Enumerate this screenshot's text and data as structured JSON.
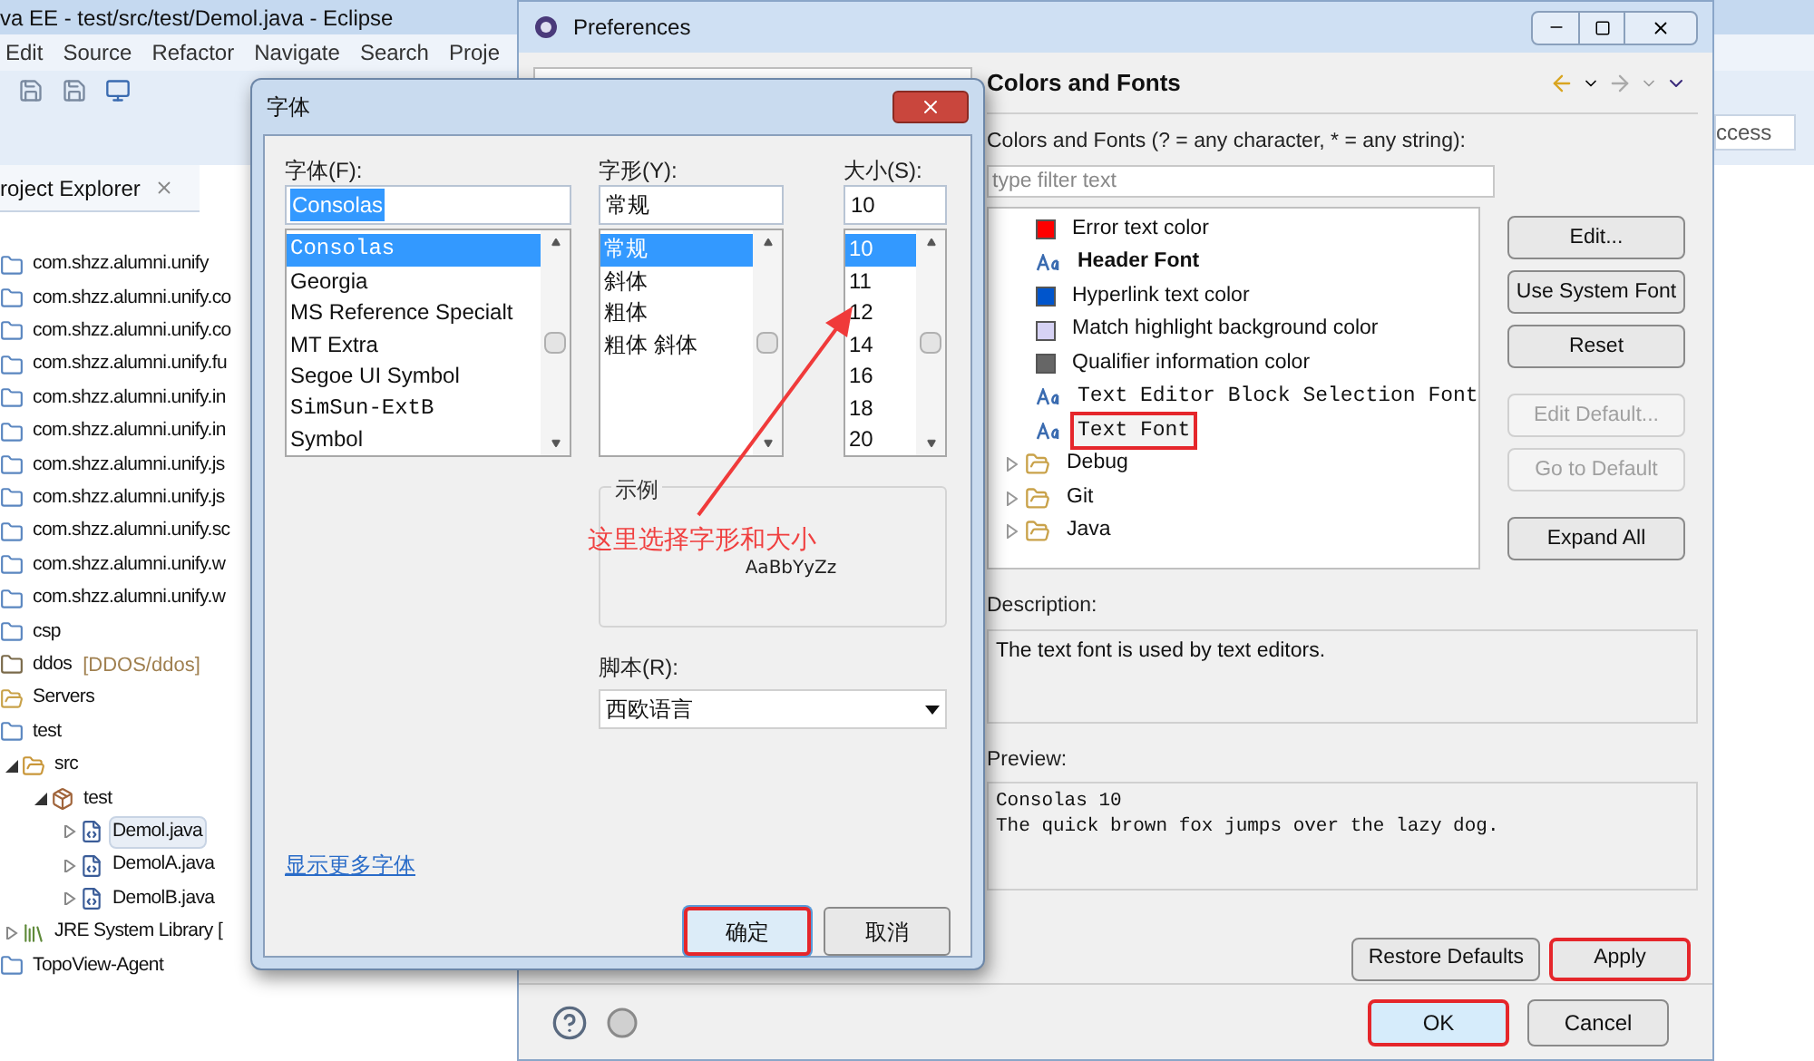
{
  "eclipse": {
    "title": "va EE - test/src/test/Demol.java - Eclipse",
    "menu": [
      "Edit",
      "Source",
      "Refactor",
      "Navigate",
      "Search",
      "Proje"
    ],
    "quick_access": "ccess"
  },
  "project_explorer": {
    "title": "roject Explorer",
    "items": [
      {
        "label": "com.shzz.alumni.unify",
        "kind": "project"
      },
      {
        "label": "com.shzz.alumni.unify.co",
        "kind": "project"
      },
      {
        "label": "com.shzz.alumni.unify.co",
        "kind": "project"
      },
      {
        "label": "com.shzz.alumni.unify.fu",
        "kind": "project"
      },
      {
        "label": "com.shzz.alumni.unify.in",
        "kind": "project"
      },
      {
        "label": "com.shzz.alumni.unify.in",
        "kind": "project"
      },
      {
        "label": "com.shzz.alumni.unify.js",
        "kind": "project"
      },
      {
        "label": "com.shzz.alumni.unify.js",
        "kind": "project"
      },
      {
        "label": "com.shzz.alumni.unify.sc",
        "kind": "project"
      },
      {
        "label": "com.shzz.alumni.unify.w",
        "kind": "project"
      },
      {
        "label": "com.shzz.alumni.unify.w",
        "kind": "project"
      },
      {
        "label": "csp",
        "kind": "project"
      },
      {
        "label": "ddos",
        "suffix": "[DDOS/ddos]",
        "kind": "repo"
      },
      {
        "label": "Servers",
        "kind": "folder"
      },
      {
        "label": "test",
        "kind": "project",
        "children": [
          {
            "label": "src",
            "kind": "source",
            "expanded": true,
            "children": [
              {
                "label": "test",
                "kind": "package",
                "expanded": true,
                "children": [
                  {
                    "label": "Demol.java",
                    "kind": "java",
                    "expanded": false,
                    "selected": true
                  },
                  {
                    "label": "DemolA.java",
                    "kind": "java",
                    "expanded": false,
                    "selected": false
                  },
                  {
                    "label": "DemolB.java",
                    "kind": "java",
                    "expanded": false,
                    "selected": false
                  }
                ]
              }
            ]
          },
          {
            "label": "JRE System Library [",
            "kind": "library",
            "expanded": false
          }
        ]
      },
      {
        "label": "TopoView-Agent",
        "kind": "project"
      }
    ]
  },
  "preferences": {
    "title": "Preferences",
    "page_title": "Colors and Fonts",
    "filter_label": "Colors and Fonts (? = any character, * = any string):",
    "filter_placeholder": "type filter text",
    "tree": [
      {
        "label": "Error text color",
        "kind": "color",
        "color": "#ff0000",
        "selected": false,
        "annotated": false
      },
      {
        "label": "Header Font",
        "kind": "font",
        "selected": false,
        "annotated": false
      },
      {
        "label": "Hyperlink text color",
        "kind": "color",
        "color": "#0055cc",
        "selected": false,
        "annotated": false
      },
      {
        "label": "Match highlight background color",
        "kind": "color",
        "color": "#d6d2f4",
        "selected": false,
        "annotated": false
      },
      {
        "label": "Qualifier information color",
        "kind": "color",
        "color": "#666666",
        "selected": false,
        "annotated": false
      },
      {
        "label": "Text Editor Block Selection Font",
        "kind": "font",
        "selected": false,
        "annotated": false
      },
      {
        "label": "Text Font",
        "kind": "font",
        "selected": true,
        "annotated": true
      },
      {
        "label": "Debug",
        "kind": "category",
        "expanded": false
      },
      {
        "label": "Git",
        "kind": "category",
        "expanded": false
      },
      {
        "label": "Java",
        "kind": "category",
        "expanded": false
      }
    ],
    "side_buttons": [
      {
        "label": "Edit...",
        "disabled": false
      },
      {
        "label": "Use System Font",
        "disabled": false
      },
      {
        "label": "Reset",
        "disabled": false
      },
      {
        "label": "Edit Default...",
        "disabled": true
      },
      {
        "label": "Go to Default",
        "disabled": true
      },
      {
        "label": "Expand All",
        "disabled": false
      }
    ],
    "description_label": "Description:",
    "description": "The text font is used by text editors.",
    "preview_label": "Preview:",
    "preview": [
      "Consolas 10",
      "The quick brown fox jumps over the lazy dog."
    ],
    "page_buttons": [
      {
        "label": "Restore Defaults",
        "annotated": false
      },
      {
        "label": "Apply",
        "annotated": true
      }
    ],
    "dialog_buttons": [
      {
        "label": "OK",
        "annotated": true,
        "default": true
      },
      {
        "label": "Cancel",
        "annotated": false,
        "default": false
      }
    ]
  },
  "font_dialog": {
    "title": "字体",
    "font": {
      "label": "字体(F):",
      "value": "Consolas",
      "options": [
        {
          "label": "Consolas",
          "selected": true
        },
        {
          "label": "Georgia",
          "selected": false
        },
        {
          "label": "MS Reference Specialt",
          "selected": false
        },
        {
          "label": "MT Extra",
          "selected": false
        },
        {
          "label": "Segoe UI Symbol",
          "selected": false
        },
        {
          "label": "SimSun-ExtB",
          "selected": false
        },
        {
          "label": "Symbol",
          "selected": false
        }
      ]
    },
    "style": {
      "label": "字形(Y):",
      "value": "常规",
      "options": [
        {
          "label": "常规",
          "selected": true
        },
        {
          "label": "斜体",
          "selected": false
        },
        {
          "label": "粗体",
          "selected": false
        },
        {
          "label": "粗体 斜体",
          "selected": false
        }
      ]
    },
    "size": {
      "label": "大小(S):",
      "value": "10",
      "options": [
        {
          "label": "10",
          "selected": true
        },
        {
          "label": "11",
          "selected": false
        },
        {
          "label": "12",
          "selected": false
        },
        {
          "label": "14",
          "selected": false
        },
        {
          "label": "16",
          "selected": false
        },
        {
          "label": "18",
          "selected": false
        },
        {
          "label": "20",
          "selected": false
        }
      ]
    },
    "sample_label": "示例",
    "sample": "AaBbYyZz",
    "script_label": "脚本(R):",
    "script_value": "西欧语言",
    "more_fonts": "显示更多字体",
    "buttons": [
      {
        "label": "确定",
        "annotated": true,
        "default": true
      },
      {
        "label": "取消",
        "annotated": false,
        "default": false
      }
    ]
  },
  "annotation": "这里选择字形和大小"
}
